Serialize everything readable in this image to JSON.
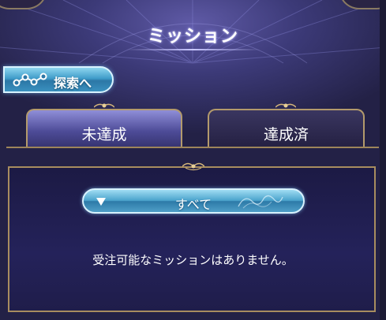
{
  "header": {
    "title": "ミッション"
  },
  "explore_button": {
    "label": "探索へ",
    "icon": "network-nodes-icon"
  },
  "tabs": [
    {
      "label": "未達成",
      "selected": true
    },
    {
      "label": "達成済",
      "selected": false
    }
  ],
  "filter": {
    "label": "すべて",
    "icon": "dropdown-triangle-icon"
  },
  "message": "受注可能なミッションはありません。",
  "colors": {
    "accent_blue": "#4aa3cc",
    "gold_trim": "#a88d5f",
    "panel_bg": "#1f1d4a"
  }
}
